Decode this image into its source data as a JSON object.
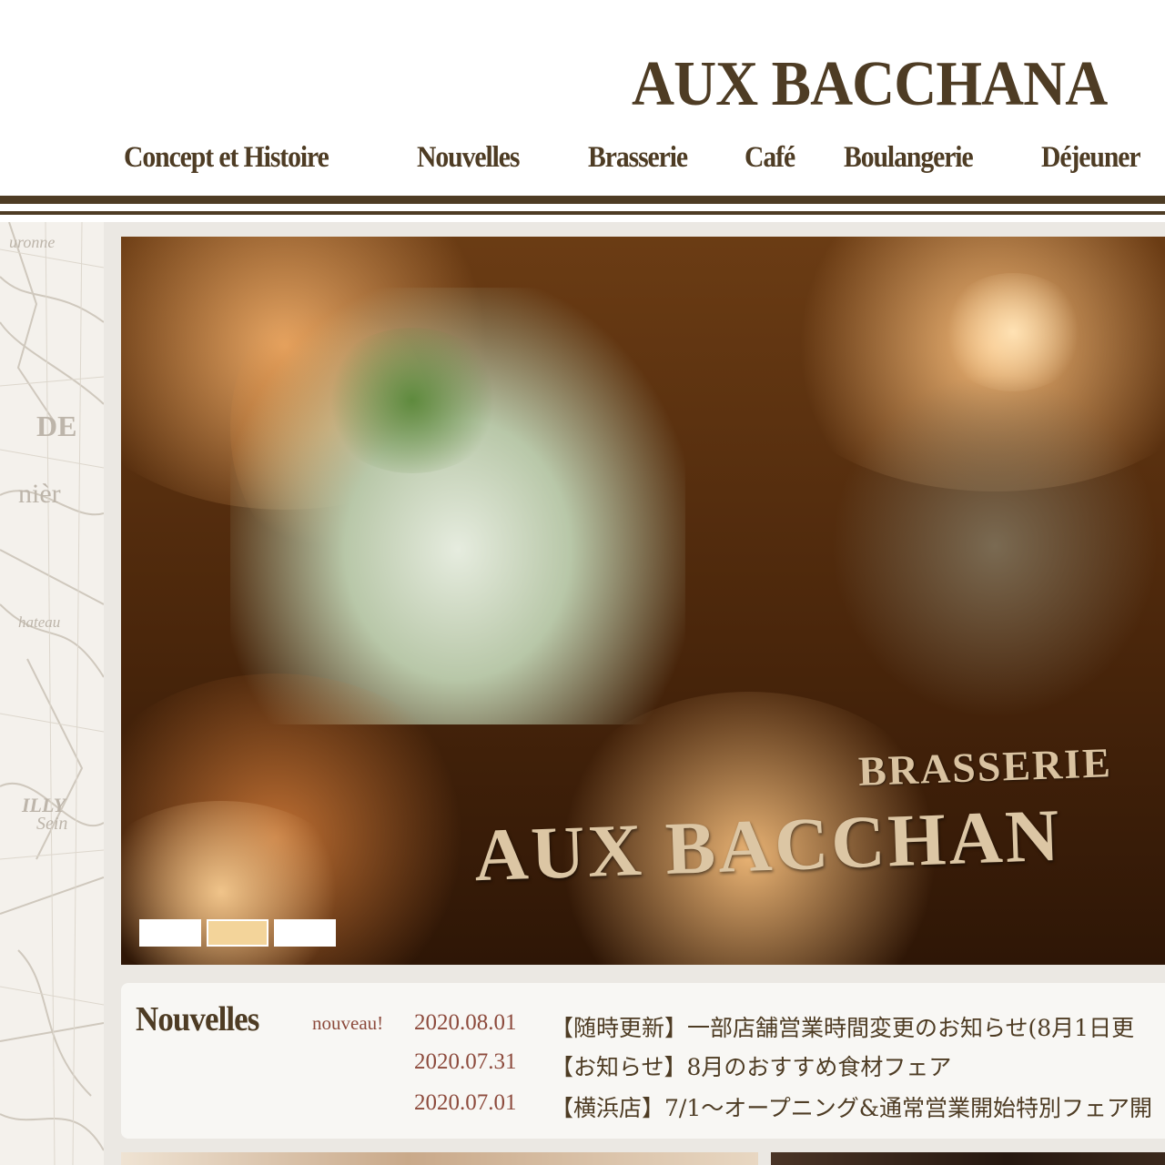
{
  "header": {
    "logo": "AUX BACCHANA",
    "nav": [
      {
        "label": "Concept et Histoire"
      },
      {
        "label": "Nouvelles"
      },
      {
        "label": "Brasserie"
      },
      {
        "label": "Café"
      },
      {
        "label": "Boulangerie"
      },
      {
        "label": "Déjeuner"
      }
    ]
  },
  "sidebar_map": {
    "words": [
      "uronne",
      "DE",
      "nièr",
      "hateau",
      "ILLY",
      "Sein"
    ]
  },
  "hero": {
    "sign_line_1": "BRASSERIE",
    "sign_line_2": "AUX BACCHAN",
    "slide_count": 3,
    "active_slide": 2
  },
  "news": {
    "title": "Nouvelles",
    "badge": "nouveau!",
    "items": [
      {
        "date": "2020.08.01",
        "text": "【随時更新】一部店舗営業時間変更のお知らせ(8月1日更"
      },
      {
        "date": "2020.07.31",
        "text": "【お知らせ】8月のおすすめ食材フェア"
      },
      {
        "date": "2020.07.01",
        "text": "【横浜店】7/1～オープニング&通常営業開始特別フェア開"
      }
    ]
  },
  "colors": {
    "brand_brown": "#4e3c24",
    "date_red": "#8d4b3d",
    "panel_bg": "#ebe8e3"
  }
}
